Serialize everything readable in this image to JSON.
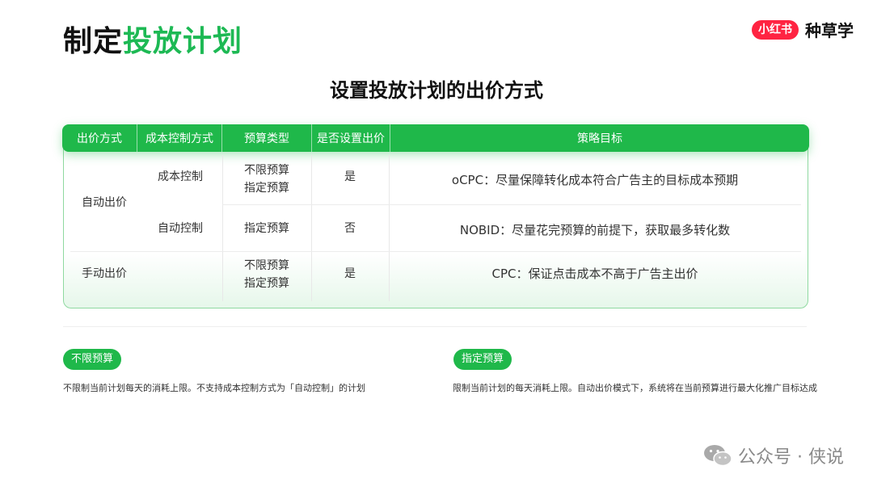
{
  "header": {
    "title_part1": "制定",
    "title_part2": "投放计划",
    "brand_badge": "小红书",
    "brand_text": "种草学"
  },
  "subtitle": "设置投放计划的出价方式",
  "table": {
    "columns": [
      "出价方式",
      "成本控制方式",
      "预算类型",
      "是否设置出价",
      "策略目标"
    ],
    "rows": [
      {
        "bid": "自动出价",
        "cost": "成本控制",
        "budget": [
          "不限预算",
          "指定预算"
        ],
        "set_bid": "是",
        "goal": "oCPC：尽量保障转化成本符合广告主的目标成本预期"
      },
      {
        "bid": "自动出价",
        "cost": "自动控制",
        "budget": [
          "指定预算"
        ],
        "set_bid": "否",
        "goal": "NOBID：尽量花完预算的前提下，获取最多转化数"
      },
      {
        "bid": "手动出价",
        "cost": "",
        "budget": [
          "不限预算",
          "指定预算"
        ],
        "set_bid": "是",
        "goal": "CPC：保证点击成本不高于广告主出价"
      }
    ]
  },
  "notes": [
    {
      "pill": "不限预算",
      "text": "不限制当前计划每天的消耗上限。不支持成本控制方式为「自动控制」的计划"
    },
    {
      "pill": "指定预算",
      "text": "限制当前计划的每天消耗上限。自动出价模式下，系统将在当前预算进行最大化推广目标达成"
    }
  ],
  "footer": {
    "label": "公众号 · 侠说",
    "icon": "wechat-icon"
  },
  "colors": {
    "accent": "#1fb84a",
    "brand": "#ff2442"
  }
}
